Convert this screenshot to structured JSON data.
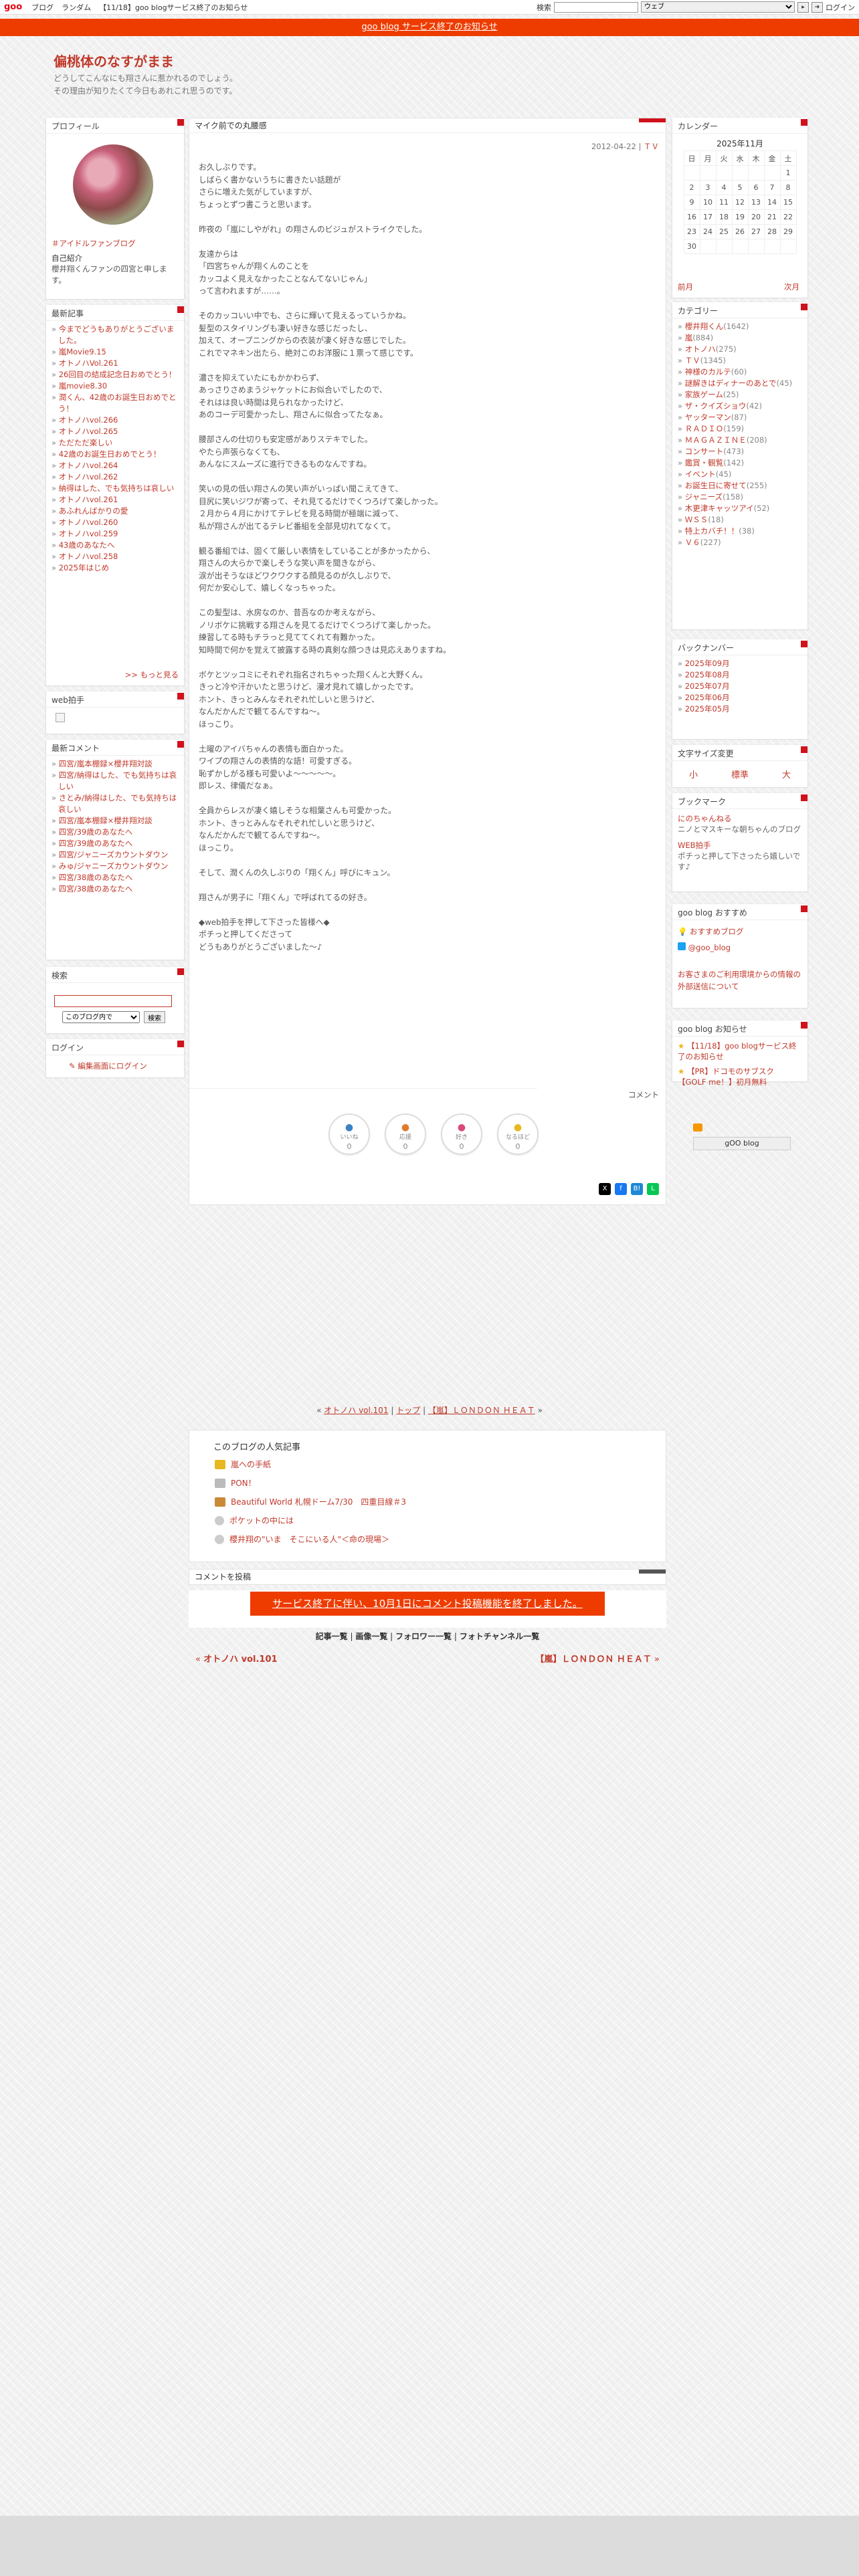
{
  "topbar": {
    "logo": "goo",
    "links": [
      "ブログ",
      "ランダム",
      "【11/18】goo blogサービス終了のお知らせ"
    ],
    "search_label": "検索",
    "search_scope": "ウェブ",
    "login": "ログイン"
  },
  "notice": "goo blog サービス終了のお知らせ",
  "blog": {
    "title": "偏桃体のなすがまま",
    "description": [
      "どうしてこんなにも翔さんに惹かれるのでしょう。",
      "その理由が知りたくて今日もあれこれ思うのです。"
    ]
  },
  "profile": {
    "heading": "プロフィール",
    "tag": "＃アイドルファンブログ",
    "intro_label": "自己紹介",
    "intro": "櫻井翔くんファンの四宮と申します。"
  },
  "recent": {
    "heading": "最新記事",
    "items": [
      "今までどうもありがとうございました。",
      "嵐Movie9.15",
      "オトノハVol.261",
      "26回目の結成記念日おめでとう！",
      "嵐movie8.30",
      "潤くん、42歳のお誕生日おめでとう！",
      "オトノハvol.266",
      "オトノハvol.265",
      "ただただ楽しい",
      "42歳のお誕生日おめでとう！",
      "オトノハvol.264",
      "オトノハvol.262",
      "納得はした、でも気持ちは哀しい",
      "オトノハvol.261",
      "あふれんばかりの愛",
      "オトノハvol.260",
      "オトノハvol.259",
      "43歳のあなたへ",
      "オトノハvol.258",
      "2025年はじめ"
    ],
    "more": ">> もっと見る"
  },
  "clap": {
    "heading": "web拍手"
  },
  "comments": {
    "heading": "最新コメント",
    "items": [
      "四宮/嵐本棚録×櫻井翔対談",
      "四宮/納得はした、でも気持ちは哀しい",
      "さとみ/納得はした、でも気持ちは哀しい",
      "四宮/嵐本棚録×櫻井翔対談",
      "四宮/39歳のあなたへ",
      "四宮/39歳のあなたへ",
      "四宮/ジャニーズカウントダウン",
      "みゅ/ジャニーズカウントダウン",
      "四宮/38歳のあなたへ",
      "四宮/38歳のあなたへ"
    ]
  },
  "search": {
    "heading": "検索",
    "scope": "このブログ内で",
    "button": "検索"
  },
  "login": {
    "heading": "ログイン",
    "link": "編集画面にログイン"
  },
  "post": {
    "title": "マイク前での丸腰感",
    "date": "2012-04-22",
    "category": "ＴＶ",
    "paragraphs": [
      "お久しぶりです。\nしばらく書かないうちに書きたい話題が\nさらに増えた気がしていますが、\nちょっとずつ書こうと思います。",
      "昨夜の「嵐にしやがれ」の翔さんのビジュがストライクでした。",
      "友達からは\n「四宮ちゃんが翔くんのことを\nカッコよく見えなかったことなんてないじゃん」\nって言われますが……。",
      "そのカッコいい中でも、さらに輝いて見えるっていうかね。\n髪型のスタイリングも凄い好きな感じだったし、\n加えて、オープニングからの衣装が凄く好きな感じでした。\nこれでマネキン出たら、絶対このお洋服に１票って感じです。",
      "濃さを抑えていたにもかかわらず、\nあっさりさめまうジャケットにお似合いでしたので、\nそれはは良い時間は見られなかったけど、\nあのコーデ可愛かったし、翔さんに似合ってたなぁ。",
      "腰部さんの仕切りも安定感がありステキでした。\nやたら声張らなくても、\nあんなにスムーズに進行できるものなんですね。",
      "笑いの見の低い翔さんの笑い声がいっぱい聞こえてきて、\n目尻に笑いジワが寄って、それ見てるだけでくつろげて楽しかった。\n２月から４月にかけてテレビを見る時間が極端に減って、\n私が翔さんが出てるテレビ番組を全部見切れてなくて。",
      "観る番組では、固くて厳しい表情をしていることが多かったから、\n翔さんの大らかで楽しそうな笑い声を聞きながら、\n涙が出そうなほどワクワクする顔見るのが久しぶりで、\n何だか安心して、嬉しくなっちゃった。",
      "この髪型は、水房なのか、昔吾なのか考えながら、\nノリボケに挑戦する翔さんを見てるだけでくつろげて楽しかった。\n練習してる時もチラっと見ててくれて有難かった。\n知時間で何かを覚えて披露する時の真剣な顔つきは見応えありますね。",
      "ボケとツッコミにそれぞれ指名されちゃった翔くんと大野くん。\nきっと冷や汗かいたと思うけど、漫才見れて嬉しかったです。\nホント、きっとみんなそれぞれ忙しいと思うけど、\nなんだかんだで観てるんですね〜。\nほっこり。",
      "土曜のアイバちゃんの表情も面白かった。\nワイプの翔さんの表情的な語！可愛すぎる。\n恥ずかしがる様も可愛いよ〜〜〜〜〜。\n即レス、律儀だなぁ。",
      "全員からレスが凄く嬉しそうな相葉さんも可愛かった。\nホント、きっとみんなそれぞれ忙しいと思うけど、\nなんだかんだで観てるんですね〜。\nほっこり。",
      "そして、潤くんの久しぶりの「翔くん」呼びにキュン。",
      "翔さんが男子に「翔くん」で呼ばれてるの好き。",
      "◆web拍手を押して下さった皆様へ◆\nポチっと押してくださって\nどうもありがとうございました〜♪"
    ],
    "comment_label": "コメント",
    "reactions": [
      {
        "label": "いいね",
        "count": "0",
        "icon": "thumbs-up"
      },
      {
        "label": "応援",
        "count": "0",
        "icon": "megaphone"
      },
      {
        "label": "好き",
        "count": "0",
        "icon": "heart-eyes"
      },
      {
        "label": "なるほど",
        "count": "0",
        "icon": "clap"
      }
    ]
  },
  "nav": {
    "prev": "オトノハ vol.101",
    "top": "トップ",
    "next": "【嵐】ＬＯＮＤＯＮ ＨＥＡＴ"
  },
  "popular": {
    "title": "このブログの人気記事",
    "items": [
      "嵐への手紙",
      "PON！",
      "Beautiful World 札幌ドーム7/30　四重目線＃3",
      "ポケットの中には",
      "櫻井翔の\"いま　そこにいる人\"＜命の現場＞"
    ]
  },
  "comment_post": {
    "heading": "コメントを投稿",
    "warning": "サービス終了に伴い、10月1日にコメント投稿機能を終了しました。"
  },
  "bottom_links": [
    "記事一覧",
    "画像一覧",
    "フォロワー一覧",
    "フォトチャンネル一覧"
  ],
  "prevnext": {
    "prev": "オトノハ vol.101",
    "next": "【嵐】ＬＯＮＤＯＮ ＨＥＡＴ"
  },
  "calendar": {
    "heading": "カレンダー",
    "month": "2025年11月",
    "days": [
      "日",
      "月",
      "火",
      "水",
      "木",
      "金",
      "土"
    ],
    "rows": [
      [
        "",
        "",
        "",
        "",
        "",
        "",
        "1"
      ],
      [
        "2",
        "3",
        "4",
        "5",
        "6",
        "7",
        "8"
      ],
      [
        "9",
        "10",
        "11",
        "12",
        "13",
        "14",
        "15"
      ],
      [
        "16",
        "17",
        "18",
        "19",
        "20",
        "21",
        "22"
      ],
      [
        "23",
        "24",
        "25",
        "26",
        "27",
        "28",
        "29"
      ],
      [
        "30",
        "",
        "",
        "",
        "",
        "",
        ""
      ]
    ],
    "prev": "前月",
    "next": "次月"
  },
  "categories": {
    "heading": "カテゴリー",
    "items": [
      [
        "櫻井翔くん",
        "(1642)"
      ],
      [
        "嵐",
        "(884)"
      ],
      [
        "オトノハ",
        "(275)"
      ],
      [
        "ＴＶ",
        "(1345)"
      ],
      [
        "神様のカルテ",
        "(60)"
      ],
      [
        "謎解きはディナーのあとで",
        "(45)"
      ],
      [
        "家族ゲーム",
        "(25)"
      ],
      [
        "ザ・クイズショウ",
        "(42)"
      ],
      [
        "ヤッターマン",
        "(87)"
      ],
      [
        "ＲＡＤＩＯ",
        "(159)"
      ],
      [
        "ＭＡＧＡＺＩＮＥ",
        "(208)"
      ],
      [
        "コンサート",
        "(473)"
      ],
      [
        "鑑賞・観覧",
        "(142)"
      ],
      [
        "イベント",
        "(45)"
      ],
      [
        "お誕生日に寄せて",
        "(255)"
      ],
      [
        "ジャニーズ",
        "(158)"
      ],
      [
        "木更津キャッツアイ",
        "(52)"
      ],
      [
        "ＷＳＳ",
        "(18)"
      ],
      [
        "特上カバチ！！",
        "(38)"
      ],
      [
        "Ｖ６",
        "(227)"
      ]
    ]
  },
  "backnumber": {
    "heading": "バックナンバー",
    "items": [
      "2025年09月",
      "2025年08月",
      "2025年07月",
      "2025年06月",
      "2025年05月"
    ]
  },
  "fontsize": {
    "heading": "文字サイズ変更",
    "small": "小",
    "medium": "標準",
    "large": "大"
  },
  "bookmark": {
    "heading": "ブックマーク",
    "items": [
      {
        "name": "にのちゃんねる",
        "desc": "ニノとマスキーな朝ちゃんのブログ"
      },
      {
        "name": "WEB拍手",
        "desc": "ポチっと押して下さったら嬉しいです♪"
      }
    ]
  },
  "gooreco": {
    "heading": "goo blog おすすめ",
    "reco": "おすすめブログ",
    "twitter": "@goo_blog",
    "info": "お客さまのご利用環境からの情報の外部送信について"
  },
  "goonews": {
    "heading": "goo blog お知らせ",
    "items": [
      "【11/18】goo blogサービス終了のお知らせ",
      "【PR】ドコモのサブスク【GOLF me！】初月無料"
    ]
  },
  "badge": "gOO blog"
}
